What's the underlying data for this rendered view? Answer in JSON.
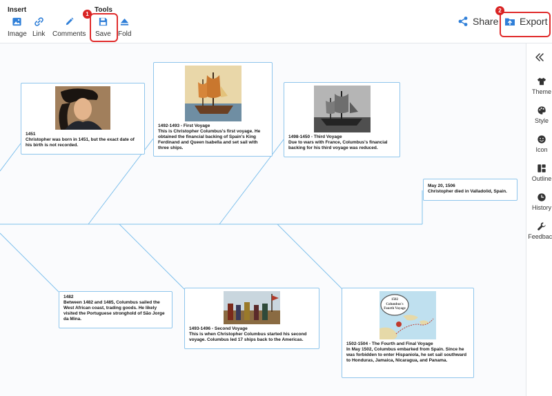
{
  "toolbar": {
    "insert_title": "Insert",
    "tools_title": "Tools",
    "image_label": "Image",
    "link_label": "Link",
    "comments_label": "Comments",
    "save_label": "Save",
    "fold_label": "Fold",
    "share_label": "Share",
    "export_label": "Export",
    "badge_save": "1",
    "badge_export": "2",
    "accent_color": "#2f7fd8",
    "highlight_color": "#e02b2b"
  },
  "cards": {
    "born": {
      "title": "1451",
      "text": "Christopher was born in 1451, but the exact date of his birth is not recorded."
    },
    "first": {
      "title": "1492-1493 - First Voyage",
      "text": "This is Christopher Columbus's first voyage. He obtained the financial backing of Spain's King Ferdinand and Queen Isabella and set sail with three ships."
    },
    "third": {
      "title": "1498-1450 - Third Voyage",
      "text": "Due to wars with France, Columbus's financial backing for his third voyage was reduced."
    },
    "died": {
      "title": "May 20, 1506",
      "text": "Christopher died in Valladolid, Spain."
    },
    "y1482": {
      "title": "1482",
      "text": "Between 1482 and 1485, Columbus sailed the West African coast, trading goods. He likely visited the Portuguese stronghold of São Jorge da Mina."
    },
    "second": {
      "title": "1493-1496 - Second Voyage",
      "text": "This is when Christopher Columbus started his second voyage. Columbus led 17 ships back to the Americas."
    },
    "fourth": {
      "title": "1502-1504 - The Fourth and Final Voyage",
      "text": "In May 1502, Columbus embarked from Spain. Since he was forbidden to enter Hispaniola, he set sail southward to Honduras, Jamaica, Nicaragua, and Panama.",
      "map_caption_year": "1502",
      "map_caption_line1": "Columbus's",
      "map_caption_line2": "Fourth Voyage"
    }
  },
  "sidebar": {
    "theme": "Theme",
    "style": "Style",
    "icon": "Icon",
    "outline": "Outline",
    "history": "History",
    "feedback": "Feedback"
  }
}
